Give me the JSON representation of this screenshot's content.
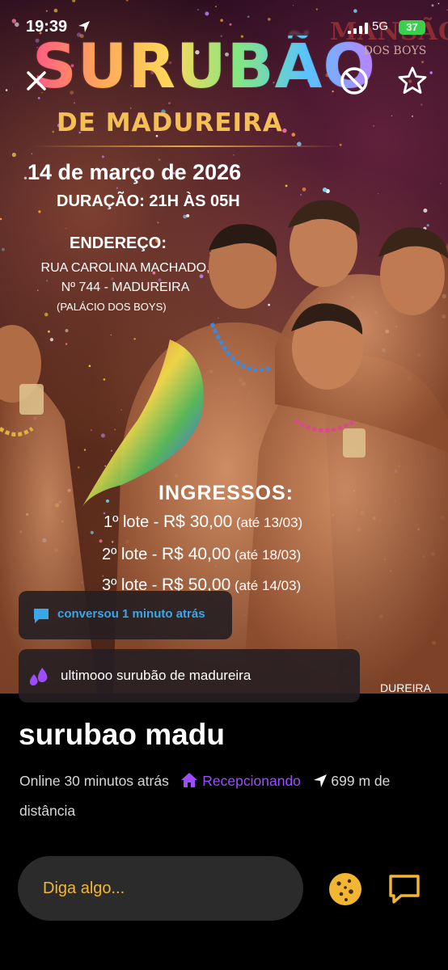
{
  "status_bar": {
    "time": "19:39",
    "network": "5G",
    "battery": "37"
  },
  "poster": {
    "title": "SURUBÃO",
    "subtitle": "DE MADUREIRA",
    "date": "14 de março de 2026",
    "duration": "DURAÇÃO: 21H ÀS 05H",
    "address_label": "ENDEREÇO:",
    "address_line1": "RUA CAROLINA MACHADO,",
    "address_line2": "Nº 744 - MADUREIRA",
    "venue": "(PALÁCIO DOS BOYS)",
    "brand_line1": "MANSÃO",
    "brand_line2": "DOS BOYS",
    "tickets_title": "INGRESSOS:",
    "tickets": [
      {
        "lot": "1º lote - ",
        "price": "R$ 30,00",
        "until": " (até 13/03)"
      },
      {
        "lot": "2º lote - ",
        "price": "R$ 40,00",
        "until": " (até 18/03)"
      },
      {
        "lot": "3º lote - ",
        "price": "R$ 50,00",
        "until": " (até 14/03)"
      }
    ],
    "bottom_fragment": "DUREIRA"
  },
  "notices": {
    "recent_chat": "conversou 1 minuto atrás",
    "status_message": "ultimooo surubão de madureira"
  },
  "profile": {
    "name": "surubao madu",
    "online": "Online 30 minutos atrás",
    "hosting": "Recepcionando",
    "distance": "699 m de distância"
  },
  "compose": {
    "placeholder": "Diga algo..."
  },
  "icons": {
    "close": "close-icon",
    "block": "block-icon",
    "favorite": "star-icon",
    "chat": "chat-bubble-icon",
    "status": "droplets-icon",
    "home": "home-icon",
    "location": "location-arrow-icon",
    "cookie": "cookie-icon",
    "message": "message-icon"
  },
  "colors": {
    "accent_yellow": "#f2b632",
    "host_purple": "#9d4dff",
    "chat_blue": "#39a7e8"
  }
}
